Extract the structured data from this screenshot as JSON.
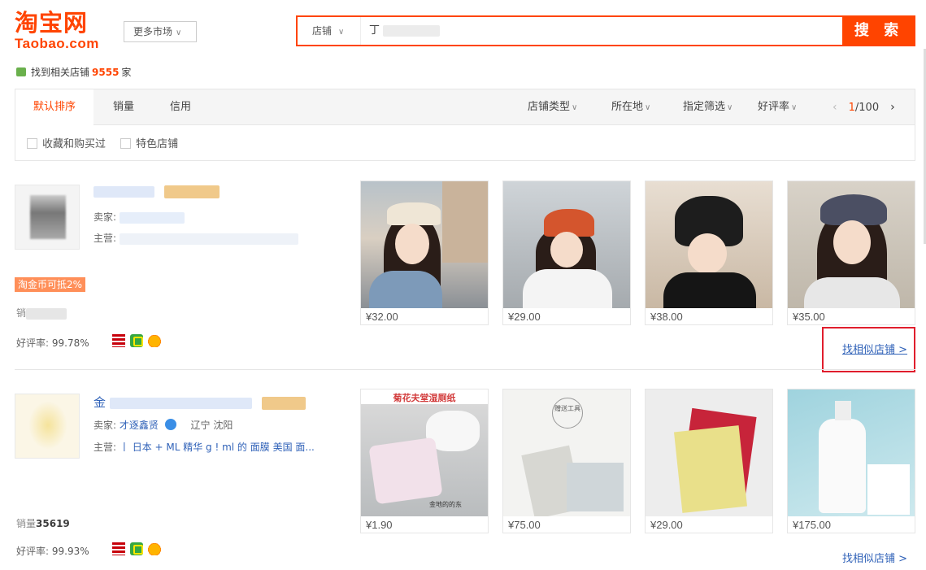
{
  "header": {
    "logo_cn": "淘宝网",
    "logo_en": "Taobao.com",
    "more_market": "更多市场",
    "search_type": "店铺",
    "search_query": "丁",
    "search_button": "搜 索"
  },
  "result": {
    "prefix": "找到相关店铺",
    "count": "9555",
    "suffix": "家"
  },
  "sortbar": {
    "tabs": [
      "默认排序",
      "销量",
      "信用"
    ],
    "filters": [
      "店铺类型",
      "所在地",
      "指定筛选",
      "好评率"
    ],
    "pager": {
      "current": "1",
      "total": "/100"
    },
    "checks": [
      "收藏和购买过",
      "特色店铺"
    ]
  },
  "shops": [
    {
      "seller_label": "卖家:",
      "main_label": "主营:",
      "coin_tag": "淘金币可抵2%",
      "sales_label": "销",
      "sales_value": "",
      "rating_label": "好评率:",
      "rating_value": "99.78%",
      "products": [
        {
          "price": "¥32.00"
        },
        {
          "price": "¥29.00"
        },
        {
          "price": "¥38.00"
        },
        {
          "price": "¥35.00"
        }
      ],
      "similar_link": "找相似店铺 >"
    },
    {
      "name_prefix": "金",
      "seller_label": "卖家:",
      "seller_name": "才逐鑫贤",
      "location": "辽宁 沈阳",
      "main_label": "主营:",
      "main_items": "丨 日本 + ML 精华 g ! ml 的 面膜 美国 面...",
      "sales_label": "销量",
      "sales_value": "35619",
      "rating_label": "好评率:",
      "rating_value": "99.93%",
      "products": [
        {
          "price": "¥1.90",
          "img_text": "菊花夫堂湿厕纸",
          "img_caption": "金地的的东"
        },
        {
          "price": "¥75.00",
          "img_text": "赠送工具"
        },
        {
          "price": "¥29.00"
        },
        {
          "price": "¥175.00"
        }
      ],
      "similar_link": "找相似店铺 >"
    }
  ],
  "colors": {
    "accent": "#ff4400",
    "link": "#3062b8",
    "highlight_box": "#e01e2d"
  }
}
